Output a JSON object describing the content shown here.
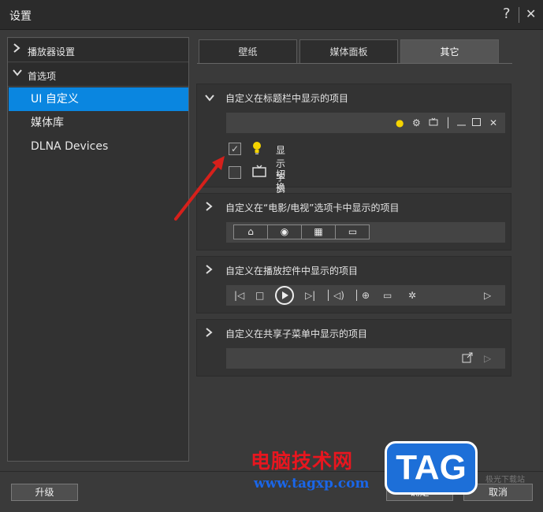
{
  "window": {
    "title": "设置",
    "help": "?",
    "close": "✕"
  },
  "sidebar": {
    "groups": [
      {
        "label": "播放器设置",
        "chevron": "›"
      },
      {
        "label": "首选项",
        "chevron": "⌄"
      }
    ],
    "items": [
      {
        "label": "UI 自定义",
        "selected": true
      },
      {
        "label": "媒体库"
      },
      {
        "label": "DLNA Devices"
      }
    ]
  },
  "tabs": [
    {
      "label": "壁纸"
    },
    {
      "label": "媒体面板"
    },
    {
      "label": "其它",
      "active": true
    }
  ],
  "sections": {
    "titlebar": {
      "title": "自定义在标题栏中显示的项目",
      "strip_icons": [
        "lightbulb-icon",
        "gear-icon",
        "tv-icon",
        "separator",
        "minimize-icon",
        "maximize-icon",
        "close-icon"
      ],
      "options": [
        {
          "label": "显示学习中心",
          "checked": true,
          "icon": "lightbulb-icon"
        },
        {
          "label": "切换至 TV 模式",
          "checked": false,
          "icon": "tv-icon"
        }
      ]
    },
    "movie_tab": {
      "title": "自定义在“电影/电视”选项卡中显示的项目",
      "segments": [
        "home-icon",
        "disc-icon",
        "film-icon",
        "tv-icon"
      ]
    },
    "playback": {
      "title": "自定义在播放控件中显示的项目",
      "controls": [
        "skip-previous-icon",
        "stop-icon",
        "play-icon",
        "skip-next-icon",
        "volume-icon",
        "zoom-icon",
        "vr-icon",
        "settings-icon",
        "screen-icon"
      ]
    },
    "share": {
      "title": "自定义在共享子菜单中显示的项目",
      "icons": [
        "external-link-icon",
        "cast-icon"
      ]
    }
  },
  "footer": {
    "upgrade": "升级",
    "ok": "确定",
    "cancel": "取消"
  },
  "watermark": {
    "site_name": "电脑技术网",
    "url": "www.tagxp.com",
    "tag": "TAG",
    "small": "极光下载站"
  },
  "colors": {
    "accent": "#0a86e0",
    "bulb": "#f5d400"
  }
}
